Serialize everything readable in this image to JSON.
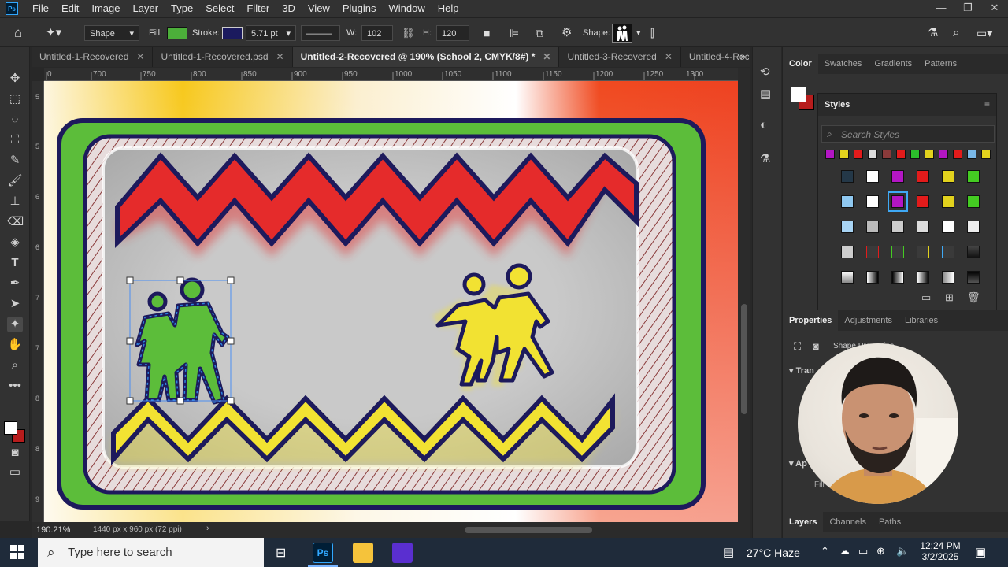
{
  "menu": [
    "File",
    "Edit",
    "Image",
    "Layer",
    "Type",
    "Select",
    "Filter",
    "3D",
    "View",
    "Plugins",
    "Window",
    "Help"
  ],
  "options": {
    "mode": "Shape",
    "fill_label": "Fill:",
    "fill_color": "#4caf3a",
    "stroke_label": "Stroke:",
    "stroke_color": "#1b1a5e",
    "stroke_width": "5.71 pt",
    "w_label": "W:",
    "w_value": "102 px",
    "h_label": "H:",
    "h_value": "120 px",
    "shape_label": "Shape:"
  },
  "tabs": [
    {
      "label": "Untitled-1-Recovered",
      "active": false
    },
    {
      "label": "Untitled-1-Recovered.psd",
      "active": false
    },
    {
      "label": "Untitled-2-Recovered @ 190% (School 2, CMYK/8#) *",
      "active": true
    },
    {
      "label": "Untitled-3-Recovered",
      "active": false
    },
    {
      "label": "Untitled-4-Reco",
      "active": false
    }
  ],
  "ruler_top": [
    "0",
    "700",
    "750",
    "800",
    "850",
    "900",
    "950",
    "1000",
    "1050",
    "1100",
    "1150",
    "1200",
    "1250",
    "1300"
  ],
  "ruler_left": [
    "5",
    "5",
    "6",
    "6",
    "7",
    "7",
    "8",
    "8",
    "9"
  ],
  "status": {
    "zoom": "190.21%",
    "doc_info": "1440 px x 960 px (72 ppi)"
  },
  "colors": {
    "zig_red": "#e52b2b",
    "zig_yellow": "#f2e232",
    "green_border": "#5cbd3a",
    "navy_outline": "#1d1a5c",
    "fg_swatch": "#ffffff",
    "bg_swatch": "#b71c1c"
  },
  "panels": {
    "color_tabs": [
      "Color",
      "Swatches",
      "Gradients",
      "Patterns"
    ],
    "styles_title": "Styles",
    "styles_search_placeholder": "Search Styles",
    "properties_tabs": [
      "Properties",
      "Adjustments",
      "Libraries"
    ],
    "shape_properties": "Shape Properties",
    "transform_label": "Tran",
    "appearance_label": "Ap",
    "fill_label": "Fill",
    "layers_tabs": [
      "Layers",
      "Channels",
      "Paths"
    ]
  },
  "taskbar": {
    "search_placeholder": "Type here to search",
    "weather": "27°C  Haze",
    "time": "12:24 PM",
    "date": "3/2/2025"
  }
}
